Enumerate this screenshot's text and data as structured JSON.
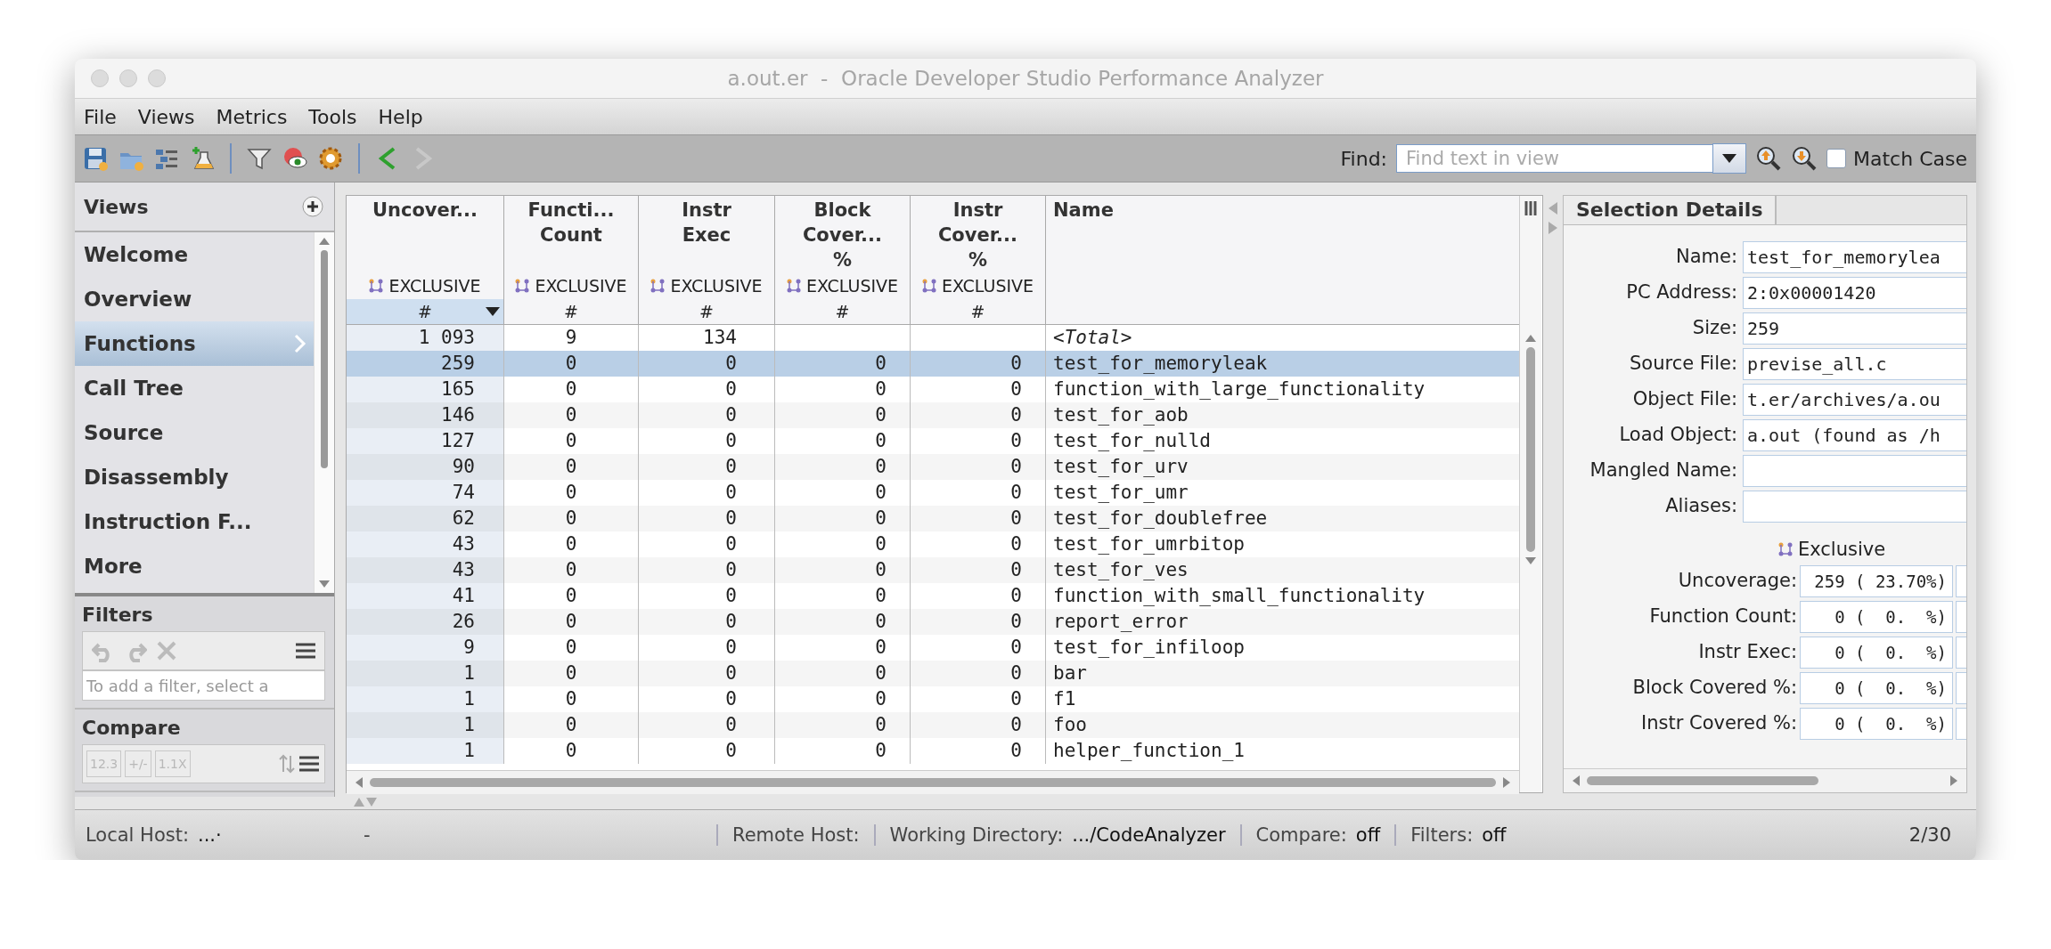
{
  "window": {
    "title": "a.out.er  -  Oracle Developer Studio Performance Analyzer"
  },
  "menu": [
    {
      "label": "File"
    },
    {
      "label": "Views"
    },
    {
      "label": "Metrics"
    },
    {
      "label": "Tools"
    },
    {
      "label": "Help"
    }
  ],
  "find": {
    "label": "Find:",
    "placeholder": "Find text in view",
    "match_case": {
      "label": "Match Case",
      "checked": false
    }
  },
  "sidebar": {
    "title": "Views",
    "items": [
      {
        "label": "Welcome",
        "selected": false
      },
      {
        "label": "Overview",
        "selected": false
      },
      {
        "label": "Functions",
        "selected": true
      },
      {
        "label": "Call Tree",
        "selected": false
      },
      {
        "label": "Source",
        "selected": false
      },
      {
        "label": "Disassembly",
        "selected": false
      },
      {
        "label": "Instruction F...",
        "selected": false
      },
      {
        "label": "More",
        "selected": false
      }
    ],
    "filters": {
      "title": "Filters",
      "placeholder": "To add a filter, select a"
    },
    "compare": {
      "title": "Compare",
      "buttons": [
        {
          "label": "12.3",
          "disabled": true
        },
        {
          "label": "+/-",
          "disabled": true
        },
        {
          "label": "1.1X",
          "disabled": true
        }
      ]
    }
  },
  "table": {
    "columns": [
      {
        "title": [
          "Uncover..."
        ],
        "metric": "EXCLUSIVE",
        "unit": "#",
        "sorted": true
      },
      {
        "title": [
          "Functi...",
          "Count"
        ],
        "metric": "EXCLUSIVE",
        "unit": "#",
        "sorted": false
      },
      {
        "title": [
          "Instr",
          "Exec"
        ],
        "metric": "EXCLUSIVE",
        "unit": "#",
        "sorted": false
      },
      {
        "title": [
          "Block",
          "Cover...",
          "%"
        ],
        "metric": "EXCLUSIVE",
        "unit": "#",
        "sorted": false
      },
      {
        "title": [
          "Instr",
          "Cover...",
          "%"
        ],
        "metric": "EXCLUSIVE",
        "unit": "#",
        "sorted": false
      },
      {
        "title": [
          "Name"
        ]
      }
    ],
    "rows": [
      {
        "kind": "total",
        "selected": false,
        "cells": [
          "1 093",
          "9",
          "134",
          "",
          "",
          "<Total>"
        ]
      },
      {
        "kind": "function",
        "selected": true,
        "cells": [
          "259",
          "0",
          "0",
          "0",
          "0",
          "test_for_memoryleak"
        ]
      },
      {
        "kind": "function",
        "selected": false,
        "cells": [
          "165",
          "0",
          "0",
          "0",
          "0",
          "function_with_large_functionality"
        ]
      },
      {
        "kind": "function",
        "selected": false,
        "cells": [
          "146",
          "0",
          "0",
          "0",
          "0",
          "test_for_aob"
        ]
      },
      {
        "kind": "function",
        "selected": false,
        "cells": [
          "127",
          "0",
          "0",
          "0",
          "0",
          "test_for_nulld"
        ]
      },
      {
        "kind": "function",
        "selected": false,
        "cells": [
          "90",
          "0",
          "0",
          "0",
          "0",
          "test_for_urv"
        ]
      },
      {
        "kind": "function",
        "selected": false,
        "cells": [
          "74",
          "0",
          "0",
          "0",
          "0",
          "test_for_umr"
        ]
      },
      {
        "kind": "function",
        "selected": false,
        "cells": [
          "62",
          "0",
          "0",
          "0",
          "0",
          "test_for_doublefree"
        ]
      },
      {
        "kind": "function",
        "selected": false,
        "cells": [
          "43",
          "0",
          "0",
          "0",
          "0",
          "test_for_umrbitop"
        ]
      },
      {
        "kind": "function",
        "selected": false,
        "cells": [
          "43",
          "0",
          "0",
          "0",
          "0",
          "test_for_ves"
        ]
      },
      {
        "kind": "function",
        "selected": false,
        "cells": [
          "41",
          "0",
          "0",
          "0",
          "0",
          "function_with_small_functionality"
        ]
      },
      {
        "kind": "function",
        "selected": false,
        "cells": [
          "26",
          "0",
          "0",
          "0",
          "0",
          "report_error"
        ]
      },
      {
        "kind": "function",
        "selected": false,
        "cells": [
          "9",
          "0",
          "0",
          "0",
          "0",
          "test_for_infiloop"
        ]
      },
      {
        "kind": "function",
        "selected": false,
        "cells": [
          "1",
          "0",
          "0",
          "0",
          "0",
          "bar"
        ]
      },
      {
        "kind": "function",
        "selected": false,
        "cells": [
          "1",
          "0",
          "0",
          "0",
          "0",
          "f1"
        ]
      },
      {
        "kind": "function",
        "selected": false,
        "cells": [
          "1",
          "0",
          "0",
          "0",
          "0",
          "foo"
        ]
      },
      {
        "kind": "function",
        "selected": false,
        "cells": [
          "1",
          "0",
          "0",
          "0",
          "0",
          "helper_function_1"
        ]
      }
    ]
  },
  "details": {
    "tab": "Selection Details",
    "fields": [
      {
        "label": "Name:",
        "value": "test_for_memorylea"
      },
      {
        "label": "PC Address:",
        "value": "2:0x00001420"
      },
      {
        "label": "Size:",
        "value": "259"
      },
      {
        "label": "Source File:",
        "value": "previse_all.c"
      },
      {
        "label": "Object File:",
        "value": "t.er/archives/a.ou"
      },
      {
        "label": "Load Object:",
        "value": "a.out (found as /h"
      },
      {
        "label": "Mangled Name:"
      },
      {
        "label": "Aliases:"
      }
    ],
    "metric_heading": "Exclusive",
    "metrics": [
      {
        "label": "Uncoverage:",
        "value": "259 ( 23.70%)"
      },
      {
        "label": "Function Count:",
        "value": "0 (  0.  %)"
      },
      {
        "label": "Instr Exec:",
        "value": "0 (  0.  %)"
      },
      {
        "label": "Block Covered %:",
        "value": "0 (  0.  %)"
      },
      {
        "label": "Instr Covered %:",
        "value": "0 (  0.  %)"
      }
    ]
  },
  "status_bar": {
    "items": [
      {
        "label": "Local Host:",
        "value": "...·"
      },
      {
        "label": "-"
      },
      {
        "label": "Remote Host:"
      },
      {
        "label": "Working Directory:",
        "value": ".../CodeAnalyzer"
      },
      {
        "label": "Compare:",
        "value": "off"
      },
      {
        "label": "Filters:",
        "value": "off"
      }
    ],
    "position": "2/30"
  }
}
